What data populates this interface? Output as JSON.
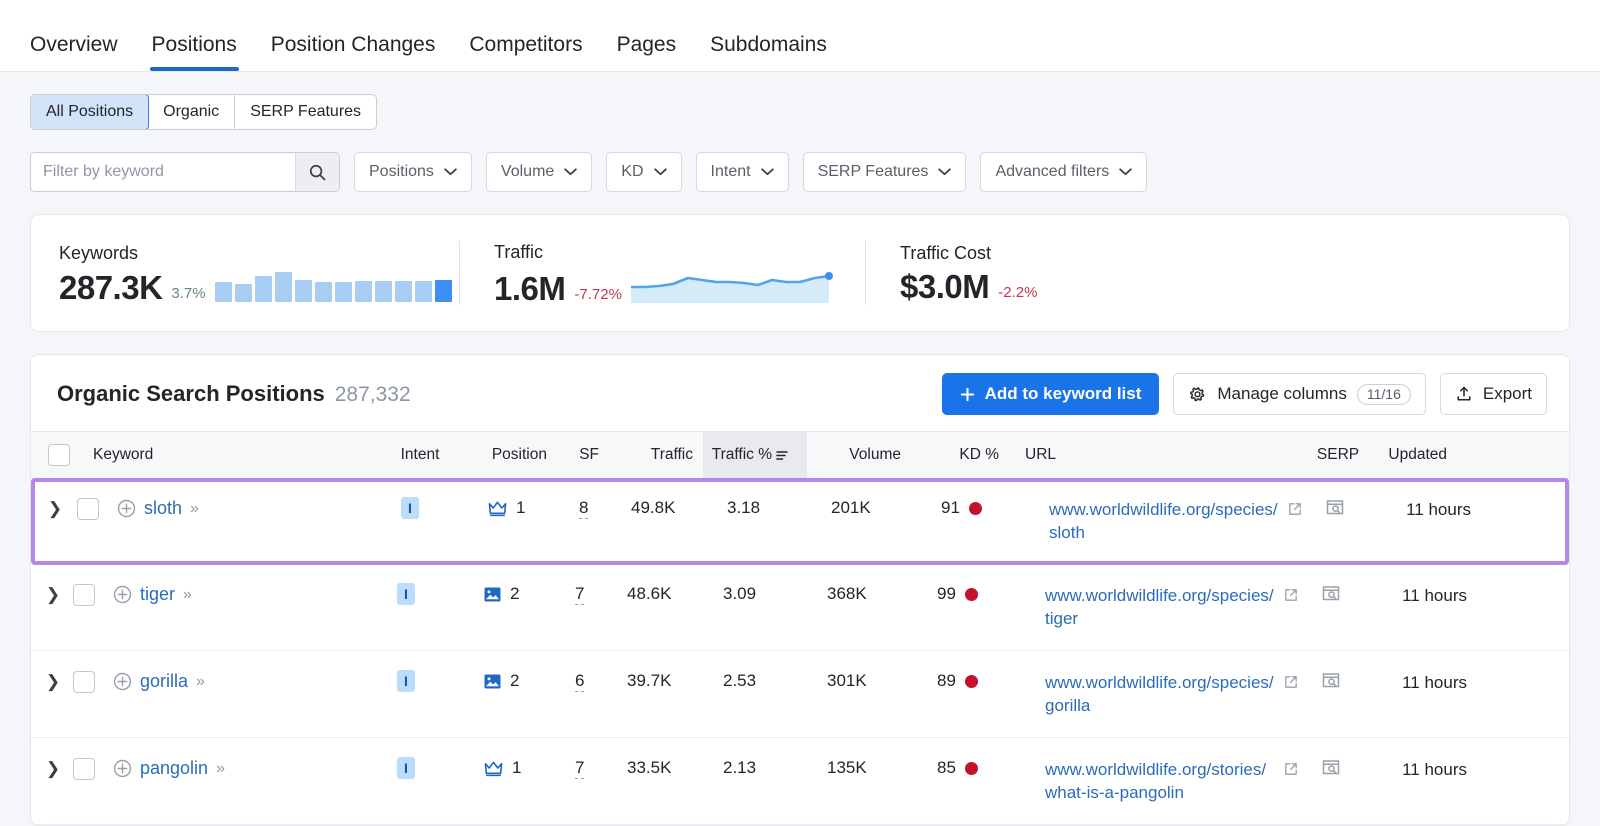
{
  "nav": {
    "tabs": [
      {
        "label": "Overview",
        "active": false
      },
      {
        "label": "Positions",
        "active": true
      },
      {
        "label": "Position Changes",
        "active": false
      },
      {
        "label": "Competitors",
        "active": false
      },
      {
        "label": "Pages",
        "active": false
      },
      {
        "label": "Subdomains",
        "active": false
      }
    ]
  },
  "segmented": {
    "items": [
      {
        "label": "All Positions",
        "selected": true
      },
      {
        "label": "Organic",
        "selected": false
      },
      {
        "label": "SERP Features",
        "selected": false
      }
    ]
  },
  "search": {
    "placeholder": "Filter by keyword",
    "value": "",
    "icon": "search-icon"
  },
  "filters": [
    {
      "label": "Positions",
      "icon": "chevron-down-icon"
    },
    {
      "label": "Volume",
      "icon": "chevron-down-icon"
    },
    {
      "label": "KD",
      "icon": "chevron-down-icon"
    },
    {
      "label": "Intent",
      "icon": "chevron-down-icon"
    },
    {
      "label": "SERP Features",
      "icon": "chevron-down-icon"
    },
    {
      "label": "Advanced filters",
      "icon": "chevron-down-icon"
    }
  ],
  "stats": {
    "keywords": {
      "label": "Keywords",
      "value": "287.3K",
      "delta": "3.7%",
      "delta_direction": "up",
      "delta_color": "#64877a"
    },
    "traffic": {
      "label": "Traffic",
      "value": "1.6M",
      "delta": "-7.72%",
      "delta_direction": "down",
      "delta_color": "#c0394b"
    },
    "traffic_cost": {
      "label": "Traffic Cost",
      "value": "$3.0M",
      "delta": "-2.2%",
      "delta_direction": "down",
      "delta_color": "#c0394b"
    }
  },
  "chart_data": [
    {
      "type": "bar",
      "title": "Keywords sparkline",
      "categories": [
        "1",
        "2",
        "3",
        "4",
        "5",
        "6",
        "7",
        "8",
        "9",
        "10",
        "11",
        "12"
      ],
      "values": [
        20,
        18,
        26,
        30,
        22,
        20,
        20,
        21,
        21,
        21,
        21,
        22
      ],
      "ylim": [
        0,
        34
      ],
      "xlabel": "",
      "ylabel": "",
      "grid": false,
      "legend": "none",
      "colors": {
        "bar": "#a8cdf4",
        "last_bar": "#3d8ef5"
      }
    },
    {
      "type": "area",
      "title": "Traffic sparkline",
      "x": [
        0,
        1,
        2,
        3,
        4,
        5,
        6,
        7,
        8,
        9,
        10,
        11,
        12,
        13,
        14
      ],
      "values": [
        10,
        10,
        10.5,
        11,
        14,
        13,
        12.5,
        12.5,
        12,
        11.5,
        13,
        12.5,
        12.5,
        14,
        14.5
      ],
      "ylim": [
        0,
        20
      ],
      "xlabel": "",
      "ylabel": "",
      "grid": false,
      "legend": "none",
      "colors": {
        "line": "#52a3e8",
        "fill": "#d6ebfa",
        "end_dot": "#3d8ef5"
      }
    }
  ],
  "table": {
    "title": "Organic Search Positions",
    "count": "287,332",
    "actions": {
      "add_to_list": "Add to keyword list",
      "add_icon": "plus-icon",
      "manage_columns": "Manage columns",
      "manage_icon": "gear-icon",
      "manage_count": "11/16",
      "export": "Export",
      "export_icon": "upload-icon"
    },
    "columns": [
      {
        "key": "checkbox",
        "label": "",
        "sorted": false
      },
      {
        "key": "keyword",
        "label": "Keyword",
        "sorted": false
      },
      {
        "key": "intent",
        "label": "Intent",
        "sorted": false
      },
      {
        "key": "position",
        "label": "Position",
        "sorted": false
      },
      {
        "key": "sf",
        "label": "SF",
        "sorted": false
      },
      {
        "key": "traffic",
        "label": "Traffic",
        "sorted": false
      },
      {
        "key": "traffic_pct",
        "label": "Traffic %",
        "sorted": true,
        "sort_icon": "sort-desc-icon"
      },
      {
        "key": "volume",
        "label": "Volume",
        "sorted": false
      },
      {
        "key": "kd",
        "label": "KD %",
        "sorted": false
      },
      {
        "key": "url",
        "label": "URL",
        "sorted": false
      },
      {
        "key": "serp",
        "label": "SERP",
        "sorted": false
      },
      {
        "key": "updated",
        "label": "Updated",
        "sorted": false
      }
    ],
    "rows": [
      {
        "keyword": "sloth",
        "intent": "I",
        "position": "1",
        "position_icon": "featured-snippet-crown-icon",
        "sf": "8",
        "traffic": "49.8K",
        "traffic_pct": "3.18",
        "volume": "201K",
        "kd": "91",
        "kd_color": "#c5122b",
        "url": "www.worldwildlife.org/species/sloth",
        "updated": "11 hours",
        "highlighted": true
      },
      {
        "keyword": "tiger",
        "intent": "I",
        "position": "2",
        "position_icon": "image-pack-icon",
        "sf": "7",
        "traffic": "48.6K",
        "traffic_pct": "3.09",
        "volume": "368K",
        "kd": "99",
        "kd_color": "#c5122b",
        "url": "www.worldwildlife.org/species/tiger",
        "updated": "11 hours",
        "highlighted": false
      },
      {
        "keyword": "gorilla",
        "intent": "I",
        "position": "2",
        "position_icon": "image-pack-icon",
        "sf": "6",
        "traffic": "39.7K",
        "traffic_pct": "2.53",
        "volume": "301K",
        "kd": "89",
        "kd_color": "#c5122b",
        "url": "www.worldwildlife.org/species/gorilla",
        "updated": "11 hours",
        "highlighted": false
      },
      {
        "keyword": "pangolin",
        "intent": "I",
        "position": "1",
        "position_icon": "featured-snippet-crown-icon",
        "sf": "7",
        "traffic": "33.5K",
        "traffic_pct": "2.13",
        "volume": "135K",
        "kd": "85",
        "kd_color": "#c5122b",
        "url": "www.worldwildlife.org/stories/what-is-a-pangolin",
        "updated": "11 hours",
        "highlighted": false
      }
    ],
    "row_icons": {
      "expand": "chevron-right-icon",
      "add_keyword": "plus-circle-icon",
      "more": "double-chevron-icon",
      "external_link": "external-link-icon",
      "serp": "serp-preview-icon"
    }
  },
  "colors": {
    "accent_blue": "#1a73e8",
    "link_blue": "#2b6cb8",
    "highlight_purple": "#b388e8",
    "kd_red": "#c5122b",
    "page_bg": "#f5f6f9"
  }
}
